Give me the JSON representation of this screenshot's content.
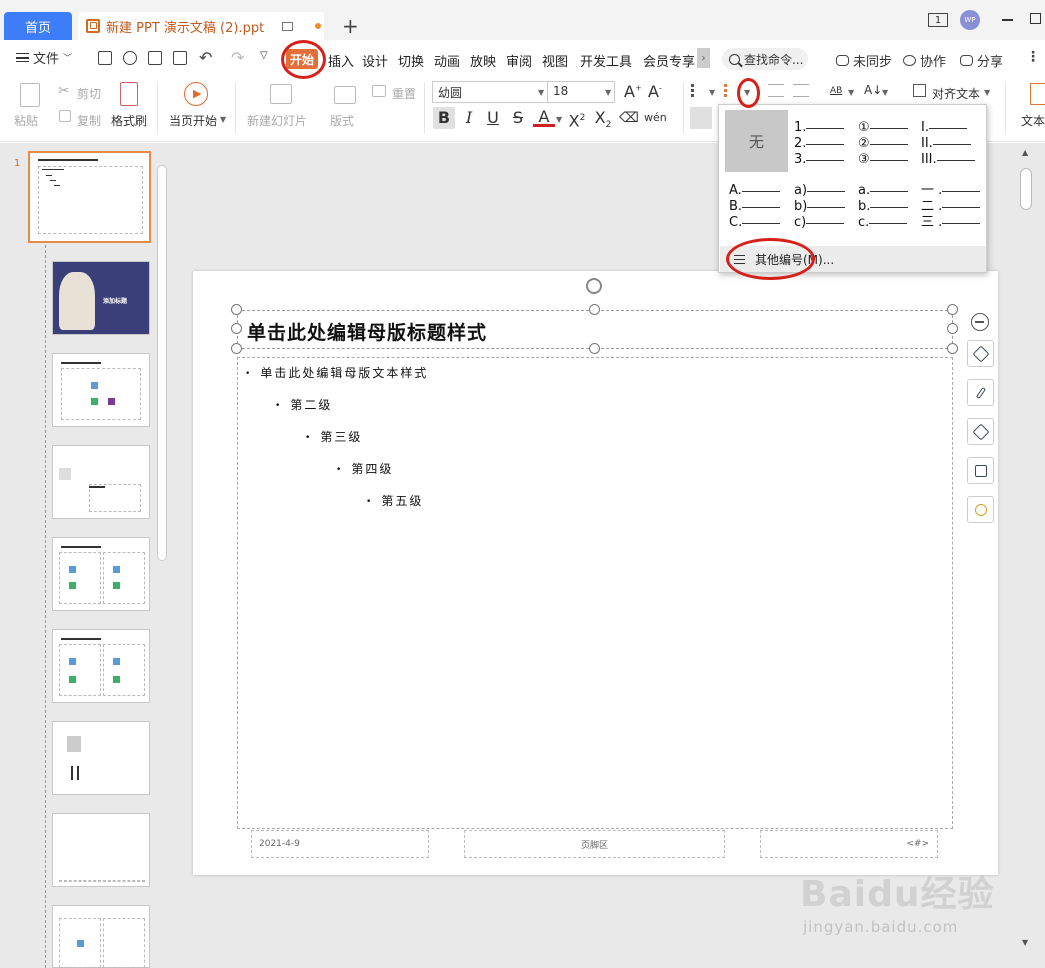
{
  "tabs": {
    "home": "首页",
    "doc": "新建 PPT 演示文稿 (2).ppt",
    "new": "+"
  },
  "window": {
    "pages_indicator": "1",
    "avatar": "WP"
  },
  "menu": {
    "file": "文件",
    "items": [
      "开始",
      "插入",
      "设计",
      "切换",
      "动画",
      "放映",
      "审阅",
      "视图",
      "开发工具",
      "会员专享"
    ],
    "search": "查找命令...",
    "sync": "未同步",
    "collab": "协作",
    "share": "分享"
  },
  "ribbon": {
    "paste": "粘贴",
    "cut": "剪切",
    "copy": "复制",
    "format_painter": "格式刷",
    "from_current": "当页开始",
    "new_slide": "新建幻灯片",
    "layout": "版式",
    "reset": "重置",
    "font_name": "幼圆",
    "font_size": "18",
    "align_text": "对齐文本",
    "text": "文本"
  },
  "numbering": {
    "none": "无",
    "col1": [
      "1.",
      "2.",
      "3."
    ],
    "col2": [
      "①",
      "②",
      "③"
    ],
    "col3": [
      "I.",
      "II.",
      "III."
    ],
    "col4": [
      "A.",
      "B.",
      "C."
    ],
    "col5": [
      "a)",
      "b)",
      "c)"
    ],
    "col6": [
      "a.",
      "b.",
      "c."
    ],
    "col7": [
      "一 .",
      "二 .",
      "三 ."
    ],
    "more": "其他编号(M)..."
  },
  "slide": {
    "title": "单击此处编辑母版标题样式",
    "levels": [
      "单击此处编辑母版文本样式",
      "第二级",
      "第三级",
      "第四级",
      "第五级"
    ],
    "footer_date": "2021-4-9",
    "footer_center": "页脚区",
    "footer_num": "<#>"
  },
  "thumbs": {
    "number": "1",
    "thumb2_title": "添加标题"
  },
  "watermark": {
    "brand": "Baidu经验",
    "url": "jingyan.baidu.com"
  },
  "colors": {
    "accent": "#3d7df7",
    "start_tab": "#e36e37",
    "annotation": "#d8201a"
  }
}
